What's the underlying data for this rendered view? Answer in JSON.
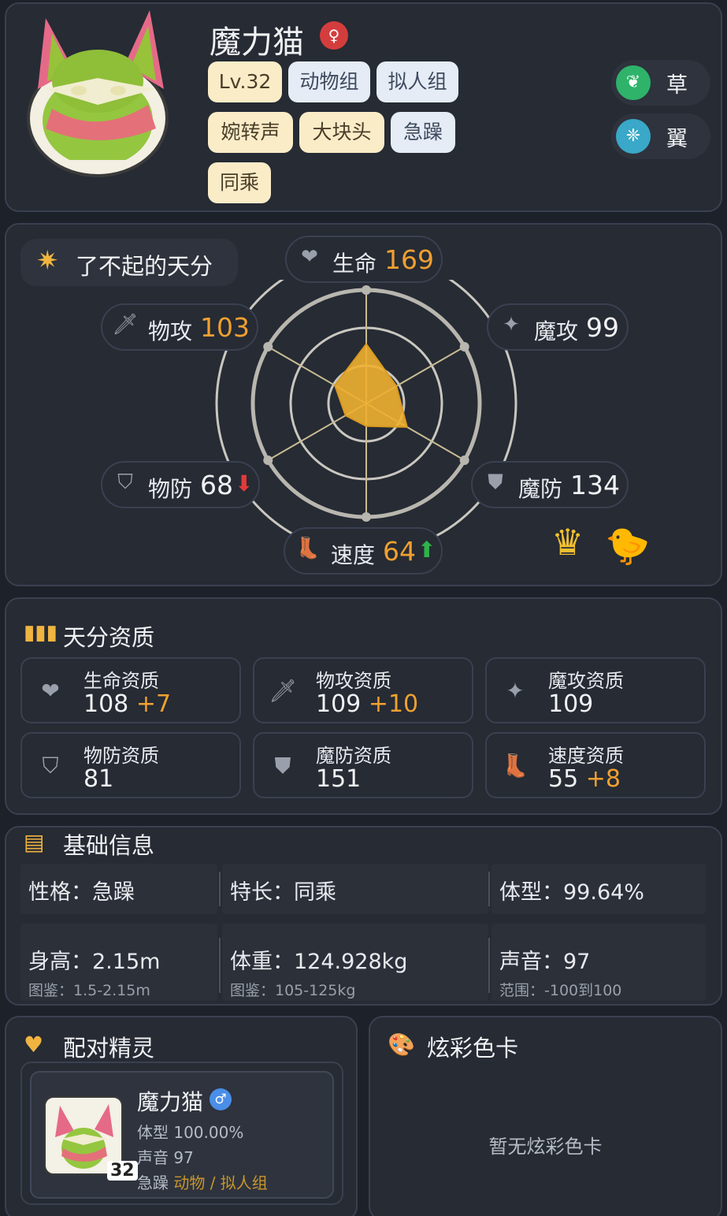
{
  "pet": {
    "name": "魔力猫",
    "gender_icon": "female-symbol-icon",
    "level": "Lv.32",
    "groups": [
      "动物组",
      "拟人组"
    ],
    "traits": [
      "婉转声",
      "大块头",
      "急躁",
      "同乘"
    ],
    "elements": [
      {
        "label": "草",
        "icon": "leaf-icon",
        "color": "#2fb36a"
      },
      {
        "label": "翼",
        "icon": "wing-icon",
        "color": "#3aa8c8"
      }
    ]
  },
  "stats_panel": {
    "talent_label": "了不起的天分",
    "stats": {
      "hp": {
        "label": "生命",
        "value": "169",
        "icon": "heart-icon"
      },
      "atk": {
        "label": "物攻",
        "value": "103",
        "icon": "sword-icon"
      },
      "matk": {
        "label": "魔攻",
        "value": "99",
        "icon": "magic-wand-icon"
      },
      "def": {
        "label": "物防",
        "value": "68",
        "modifier": "down",
        "icon": "shield-icon"
      },
      "mdef": {
        "label": "魔防",
        "value": "134",
        "icon": "magic-shield-icon"
      },
      "spd": {
        "label": "速度",
        "value": "64",
        "modifier": "up",
        "icon": "boot-icon"
      }
    }
  },
  "chart_data": {
    "type": "radar",
    "categories": [
      "生命",
      "魔攻",
      "魔防",
      "速度",
      "物防",
      "物攻"
    ],
    "values": [
      169,
      99,
      134,
      64,
      68,
      103
    ],
    "fill_color": "#f0b030"
  },
  "aptitude": {
    "title": "天分资质",
    "items": [
      {
        "label": "生命资质",
        "value": "108",
        "bonus": "+7",
        "icon": "heart-icon"
      },
      {
        "label": "物攻资质",
        "value": "109",
        "bonus": "+10",
        "icon": "sword-icon"
      },
      {
        "label": "魔攻资质",
        "value": "109",
        "bonus": "",
        "icon": "magic-wand-icon"
      },
      {
        "label": "物防资质",
        "value": "81",
        "bonus": "",
        "icon": "shield-icon"
      },
      {
        "label": "魔防资质",
        "value": "151",
        "bonus": "",
        "icon": "magic-shield-icon"
      },
      {
        "label": "速度资质",
        "value": "55",
        "bonus": "+8",
        "icon": "boot-icon"
      }
    ]
  },
  "basic_info": {
    "title": "基础信息",
    "nature": "性格：急躁",
    "specialty": "特长：同乘",
    "body_type": "体型：99.64%",
    "height": "身高：2.15m",
    "height_range": "图鉴：1.5-2.15m",
    "weight": "体重：124.928kg",
    "weight_range": "图鉴：105-125kg",
    "voice": "声音：97",
    "voice_range": "范围：-100到100"
  },
  "pair": {
    "title": "配对精灵",
    "name": "魔力猫",
    "gender_icon": "male-symbol-icon",
    "level": "32",
    "body_type": "体型 100.00%",
    "voice": "声音 97",
    "trait": "急躁",
    "groups": "动物 / 拟人组"
  },
  "color_card": {
    "title": "炫彩色卡",
    "empty_text": "暂无炫彩色卡"
  }
}
